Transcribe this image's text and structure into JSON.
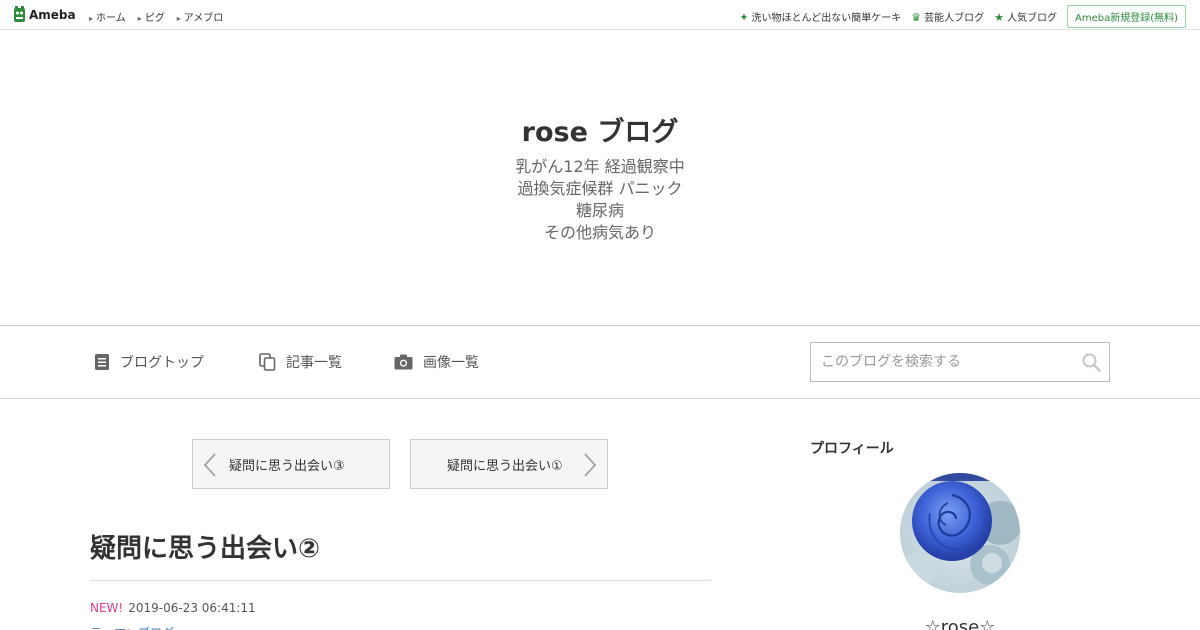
{
  "topbar": {
    "logo_text": "Ameba",
    "nav": [
      "ホーム",
      "ピグ",
      "アメブロ"
    ],
    "links": [
      {
        "label": "洗い物ほとんど出ない簡単ケーキ",
        "icon": "sparkle-icon"
      },
      {
        "label": "芸能人ブログ",
        "icon": "crown-icon"
      },
      {
        "label": "人気ブログ",
        "icon": "star-icon"
      }
    ],
    "signup_label": "Ameba新規登録(無料)"
  },
  "header": {
    "title": "rose ブログ",
    "description": [
      "乳がん12年 経過観察中",
      "過換気症候群 パニック",
      "糖尿病",
      "その他病気あり"
    ]
  },
  "nav": {
    "items": [
      {
        "label": "ブログトップ",
        "icon": "document-icon"
      },
      {
        "label": "記事一覧",
        "icon": "copy-icon"
      },
      {
        "label": "画像一覧",
        "icon": "camera-icon"
      }
    ],
    "search_placeholder": "このブログを検索する"
  },
  "pager": {
    "prev_label": "疑問に思う出会い③",
    "next_label": "疑問に思う出会い①"
  },
  "article": {
    "title": "疑問に思う出会い②",
    "new_badge": "NEW!",
    "datetime": "2019-06-23 06:41:11",
    "theme": "テーマ：ブログ"
  },
  "sidebar": {
    "title": "プロフィール",
    "profile_name": "☆rose☆"
  },
  "colors": {
    "accent_green": "#2d8c3c",
    "new_pink": "#e03c8a",
    "link_blue": "#4a7fc1"
  }
}
